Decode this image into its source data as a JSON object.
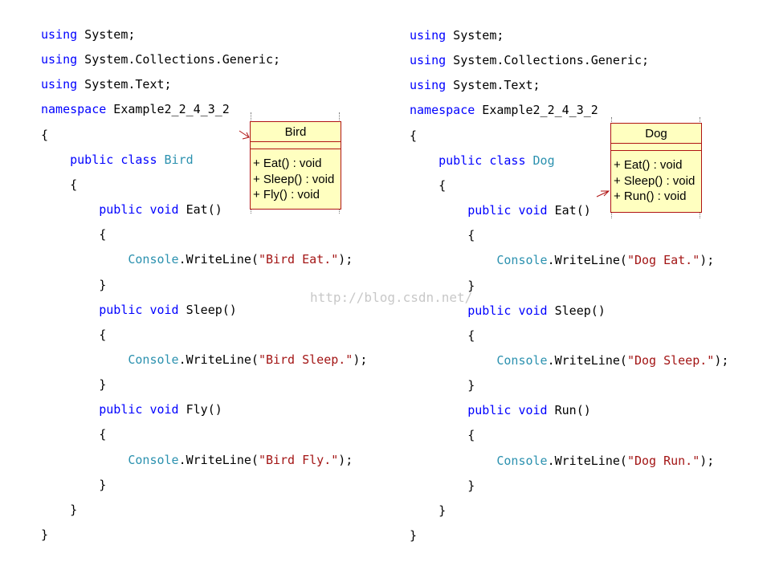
{
  "panels": [
    {
      "lines": [
        [
          {
            "t": "kw",
            "v": "using"
          },
          {
            "t": "plain",
            "v": " System;"
          }
        ],
        [
          {
            "t": "kw",
            "v": "using"
          },
          {
            "t": "plain",
            "v": " System.Collections.Generic;"
          }
        ],
        [
          {
            "t": "kw",
            "v": "using"
          },
          {
            "t": "plain",
            "v": " System.Text;"
          }
        ],
        [
          {
            "t": "kw",
            "v": "namespace"
          },
          {
            "t": "plain",
            "v": " Example2_2_4_3_2"
          }
        ],
        [
          {
            "t": "plain",
            "v": "{"
          }
        ],
        [
          {
            "t": "plain",
            "v": "    "
          },
          {
            "t": "kw",
            "v": "public class"
          },
          {
            "t": "plain",
            "v": " "
          },
          {
            "t": "type",
            "v": "Bird"
          }
        ],
        [
          {
            "t": "plain",
            "v": "    {"
          }
        ],
        [
          {
            "t": "plain",
            "v": "        "
          },
          {
            "t": "kw",
            "v": "public void"
          },
          {
            "t": "plain",
            "v": " Eat()"
          }
        ],
        [
          {
            "t": "plain",
            "v": "        {"
          }
        ],
        [
          {
            "t": "plain",
            "v": "            "
          },
          {
            "t": "type",
            "v": "Console"
          },
          {
            "t": "plain",
            "v": ".WriteLine("
          },
          {
            "t": "str",
            "v": "\"Bird Eat.\""
          },
          {
            "t": "plain",
            "v": ");"
          }
        ],
        [
          {
            "t": "plain",
            "v": "        }"
          }
        ],
        [
          {
            "t": "plain",
            "v": "        "
          },
          {
            "t": "kw",
            "v": "public void"
          },
          {
            "t": "plain",
            "v": " Sleep()"
          }
        ],
        [
          {
            "t": "plain",
            "v": "        {"
          }
        ],
        [
          {
            "t": "plain",
            "v": "            "
          },
          {
            "t": "type",
            "v": "Console"
          },
          {
            "t": "plain",
            "v": ".WriteLine("
          },
          {
            "t": "str",
            "v": "\"Bird Sleep.\""
          },
          {
            "t": "plain",
            "v": ");"
          }
        ],
        [
          {
            "t": "plain",
            "v": "        }"
          }
        ],
        [
          {
            "t": "plain",
            "v": "        "
          },
          {
            "t": "kw",
            "v": "public void"
          },
          {
            "t": "plain",
            "v": " Fly()"
          }
        ],
        [
          {
            "t": "plain",
            "v": "        {"
          }
        ],
        [
          {
            "t": "plain",
            "v": "            "
          },
          {
            "t": "type",
            "v": "Console"
          },
          {
            "t": "plain",
            "v": ".WriteLine("
          },
          {
            "t": "str",
            "v": "\"Bird Fly.\""
          },
          {
            "t": "plain",
            "v": ");"
          }
        ],
        [
          {
            "t": "plain",
            "v": "        }"
          }
        ],
        [
          {
            "t": "plain",
            "v": "    }"
          }
        ],
        [
          {
            "t": "plain",
            "v": "}"
          }
        ]
      ],
      "uml": {
        "name": "Bird",
        "ops": [
          "+ Eat() : void",
          "+ Sleep() : void",
          "+ Fly() : void"
        ]
      }
    },
    {
      "lines": [
        [
          {
            "t": "kw",
            "v": "using"
          },
          {
            "t": "plain",
            "v": " System;"
          }
        ],
        [
          {
            "t": "kw",
            "v": "using"
          },
          {
            "t": "plain",
            "v": " System.Collections.Generic;"
          }
        ],
        [
          {
            "t": "kw",
            "v": "using"
          },
          {
            "t": "plain",
            "v": " System.Text;"
          }
        ],
        [
          {
            "t": "kw",
            "v": "namespace"
          },
          {
            "t": "plain",
            "v": " Example2_2_4_3_2"
          }
        ],
        [
          {
            "t": "plain",
            "v": "{"
          }
        ],
        [
          {
            "t": "plain",
            "v": "    "
          },
          {
            "t": "kw",
            "v": "public class"
          },
          {
            "t": "plain",
            "v": " "
          },
          {
            "t": "type",
            "v": "Dog"
          }
        ],
        [
          {
            "t": "plain",
            "v": "    {"
          }
        ],
        [
          {
            "t": "plain",
            "v": "        "
          },
          {
            "t": "kw",
            "v": "public void"
          },
          {
            "t": "plain",
            "v": " Eat()"
          }
        ],
        [
          {
            "t": "plain",
            "v": "        {"
          }
        ],
        [
          {
            "t": "plain",
            "v": "            "
          },
          {
            "t": "type",
            "v": "Console"
          },
          {
            "t": "plain",
            "v": ".WriteLine("
          },
          {
            "t": "str",
            "v": "\"Dog Eat.\""
          },
          {
            "t": "plain",
            "v": ");"
          }
        ],
        [
          {
            "t": "plain",
            "v": "        }"
          }
        ],
        [
          {
            "t": "plain",
            "v": "        "
          },
          {
            "t": "kw",
            "v": "public void"
          },
          {
            "t": "plain",
            "v": " Sleep()"
          }
        ],
        [
          {
            "t": "plain",
            "v": "        {"
          }
        ],
        [
          {
            "t": "plain",
            "v": "            "
          },
          {
            "t": "type",
            "v": "Console"
          },
          {
            "t": "plain",
            "v": ".WriteLine("
          },
          {
            "t": "str",
            "v": "\"Dog Sleep.\""
          },
          {
            "t": "plain",
            "v": ");"
          }
        ],
        [
          {
            "t": "plain",
            "v": "        }"
          }
        ],
        [
          {
            "t": "plain",
            "v": "        "
          },
          {
            "t": "kw",
            "v": "public void"
          },
          {
            "t": "plain",
            "v": " Run()"
          }
        ],
        [
          {
            "t": "plain",
            "v": "        {"
          }
        ],
        [
          {
            "t": "plain",
            "v": "            "
          },
          {
            "t": "type",
            "v": "Console"
          },
          {
            "t": "plain",
            "v": ".WriteLine("
          },
          {
            "t": "str",
            "v": "\"Dog Run.\""
          },
          {
            "t": "plain",
            "v": ");"
          }
        ],
        [
          {
            "t": "plain",
            "v": "        }"
          }
        ],
        [
          {
            "t": "plain",
            "v": "    }"
          }
        ],
        [
          {
            "t": "plain",
            "v": "}"
          }
        ]
      ],
      "uml": {
        "name": "Dog",
        "ops": [
          "+ Eat() : void",
          "+ Sleep() : void",
          "+ Run() : void"
        ]
      }
    }
  ],
  "watermark": "http://blog.csdn.net/",
  "colors": {
    "keyword": "#0000ff",
    "type": "#2b91af",
    "string": "#a31515",
    "uml_fill": "#ffffc0",
    "uml_border": "#b01414"
  }
}
